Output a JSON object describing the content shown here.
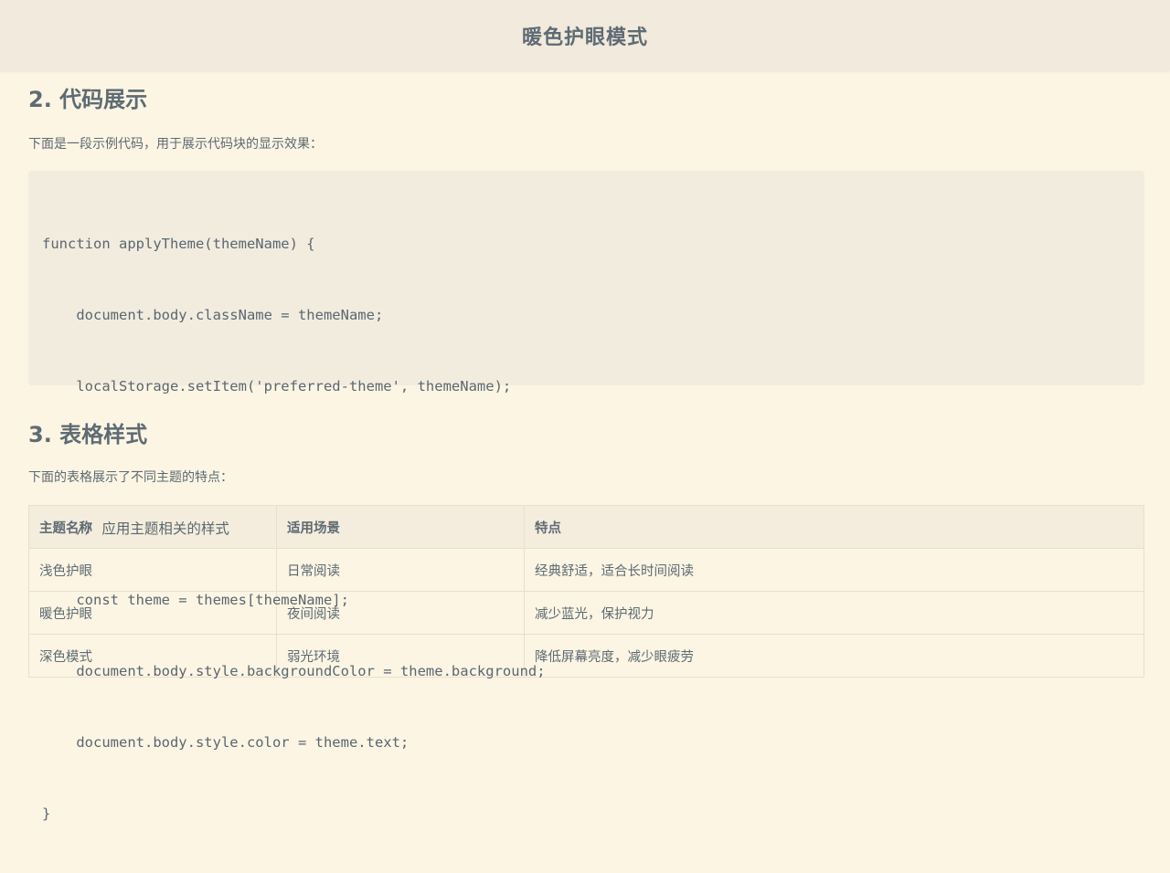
{
  "header": {
    "title": "暖色护眼模式"
  },
  "section2": {
    "title": "2. 代码展示",
    "description": "下面是一段示例代码，用于展示代码块的显示效果：",
    "code_lines": [
      "function applyTheme(themeName) {",
      "    document.body.className = themeName;",
      "    localStorage.setItem('preferred-theme', themeName);",
      "",
      "    // 应用主题相关的样式",
      "    const theme = themes[themeName];",
      "    document.body.style.backgroundColor = theme.background;",
      "    document.body.style.color = theme.text;",
      "}"
    ]
  },
  "section3": {
    "title": "3. 表格样式",
    "description": "下面的表格展示了不同主题的特点：",
    "table": {
      "headers": [
        "主题名称",
        "适用场景",
        "特点"
      ],
      "rows": [
        [
          "浅色护眼",
          "日常阅读",
          "经典舒适，适合长时间阅读"
        ],
        [
          "暖色护眼",
          "夜间阅读",
          "减少蓝光，保护视力"
        ],
        [
          "深色模式",
          "弱光环境",
          "降低屏幕亮度，减少眼疲劳"
        ]
      ]
    }
  },
  "colors": {
    "page_background": "#fcf5e4",
    "header_background": "#f1eadd",
    "code_background": "#f2ecdf",
    "text": "#5d6a72",
    "table_border": "#e8dfcc"
  }
}
